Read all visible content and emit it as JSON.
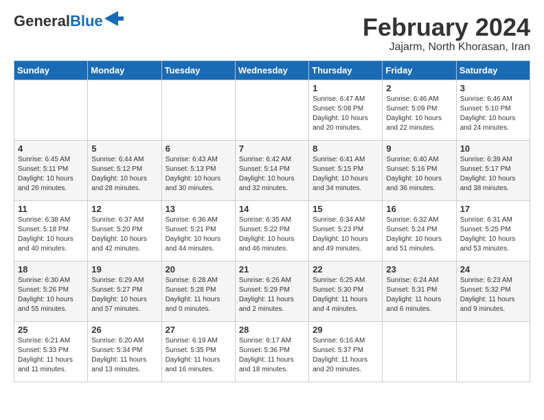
{
  "header": {
    "logo_general": "General",
    "logo_blue": "Blue",
    "month_title": "February 2024",
    "subtitle": "Jajarm, North Khorasan, Iran"
  },
  "days_of_week": [
    "Sunday",
    "Monday",
    "Tuesday",
    "Wednesday",
    "Thursday",
    "Friday",
    "Saturday"
  ],
  "weeks": [
    [
      {
        "day": "",
        "content": ""
      },
      {
        "day": "",
        "content": ""
      },
      {
        "day": "",
        "content": ""
      },
      {
        "day": "",
        "content": ""
      },
      {
        "day": "1",
        "content": "Sunrise: 6:47 AM\nSunset: 5:08 PM\nDaylight: 10 hours\nand 20 minutes."
      },
      {
        "day": "2",
        "content": "Sunrise: 6:46 AM\nSunset: 5:09 PM\nDaylight: 10 hours\nand 22 minutes."
      },
      {
        "day": "3",
        "content": "Sunrise: 6:46 AM\nSunset: 5:10 PM\nDaylight: 10 hours\nand 24 minutes."
      }
    ],
    [
      {
        "day": "4",
        "content": "Sunrise: 6:45 AM\nSunset: 5:11 PM\nDaylight: 10 hours\nand 26 minutes."
      },
      {
        "day": "5",
        "content": "Sunrise: 6:44 AM\nSunset: 5:12 PM\nDaylight: 10 hours\nand 28 minutes."
      },
      {
        "day": "6",
        "content": "Sunrise: 6:43 AM\nSunset: 5:13 PM\nDaylight: 10 hours\nand 30 minutes."
      },
      {
        "day": "7",
        "content": "Sunrise: 6:42 AM\nSunset: 5:14 PM\nDaylight: 10 hours\nand 32 minutes."
      },
      {
        "day": "8",
        "content": "Sunrise: 6:41 AM\nSunset: 5:15 PM\nDaylight: 10 hours\nand 34 minutes."
      },
      {
        "day": "9",
        "content": "Sunrise: 6:40 AM\nSunset: 5:16 PM\nDaylight: 10 hours\nand 36 minutes."
      },
      {
        "day": "10",
        "content": "Sunrise: 6:39 AM\nSunset: 5:17 PM\nDaylight: 10 hours\nand 38 minutes."
      }
    ],
    [
      {
        "day": "11",
        "content": "Sunrise: 6:38 AM\nSunset: 5:18 PM\nDaylight: 10 hours\nand 40 minutes."
      },
      {
        "day": "12",
        "content": "Sunrise: 6:37 AM\nSunset: 5:20 PM\nDaylight: 10 hours\nand 42 minutes."
      },
      {
        "day": "13",
        "content": "Sunrise: 6:36 AM\nSunset: 5:21 PM\nDaylight: 10 hours\nand 44 minutes."
      },
      {
        "day": "14",
        "content": "Sunrise: 6:35 AM\nSunset: 5:22 PM\nDaylight: 10 hours\nand 46 minutes."
      },
      {
        "day": "15",
        "content": "Sunrise: 6:34 AM\nSunset: 5:23 PM\nDaylight: 10 hours\nand 49 minutes."
      },
      {
        "day": "16",
        "content": "Sunrise: 6:32 AM\nSunset: 5:24 PM\nDaylight: 10 hours\nand 51 minutes."
      },
      {
        "day": "17",
        "content": "Sunrise: 6:31 AM\nSunset: 5:25 PM\nDaylight: 10 hours\nand 53 minutes."
      }
    ],
    [
      {
        "day": "18",
        "content": "Sunrise: 6:30 AM\nSunset: 5:26 PM\nDaylight: 10 hours\nand 55 minutes."
      },
      {
        "day": "19",
        "content": "Sunrise: 6:29 AM\nSunset: 5:27 PM\nDaylight: 10 hours\nand 57 minutes."
      },
      {
        "day": "20",
        "content": "Sunrise: 6:28 AM\nSunset: 5:28 PM\nDaylight: 11 hours\nand 0 minutes."
      },
      {
        "day": "21",
        "content": "Sunrise: 6:26 AM\nSunset: 5:29 PM\nDaylight: 11 hours\nand 2 minutes."
      },
      {
        "day": "22",
        "content": "Sunrise: 6:25 AM\nSunset: 5:30 PM\nDaylight: 11 hours\nand 4 minutes."
      },
      {
        "day": "23",
        "content": "Sunrise: 6:24 AM\nSunset: 5:31 PM\nDaylight: 11 hours\nand 6 minutes."
      },
      {
        "day": "24",
        "content": "Sunrise: 6:23 AM\nSunset: 5:32 PM\nDaylight: 11 hours\nand 9 minutes."
      }
    ],
    [
      {
        "day": "25",
        "content": "Sunrise: 6:21 AM\nSunset: 5:33 PM\nDaylight: 11 hours\nand 11 minutes."
      },
      {
        "day": "26",
        "content": "Sunrise: 6:20 AM\nSunset: 5:34 PM\nDaylight: 11 hours\nand 13 minutes."
      },
      {
        "day": "27",
        "content": "Sunrise: 6:19 AM\nSunset: 5:35 PM\nDaylight: 11 hours\nand 16 minutes."
      },
      {
        "day": "28",
        "content": "Sunrise: 6:17 AM\nSunset: 5:36 PM\nDaylight: 11 hours\nand 18 minutes."
      },
      {
        "day": "29",
        "content": "Sunrise: 6:16 AM\nSunset: 5:37 PM\nDaylight: 11 hours\nand 20 minutes."
      },
      {
        "day": "",
        "content": ""
      },
      {
        "day": "",
        "content": ""
      }
    ]
  ]
}
